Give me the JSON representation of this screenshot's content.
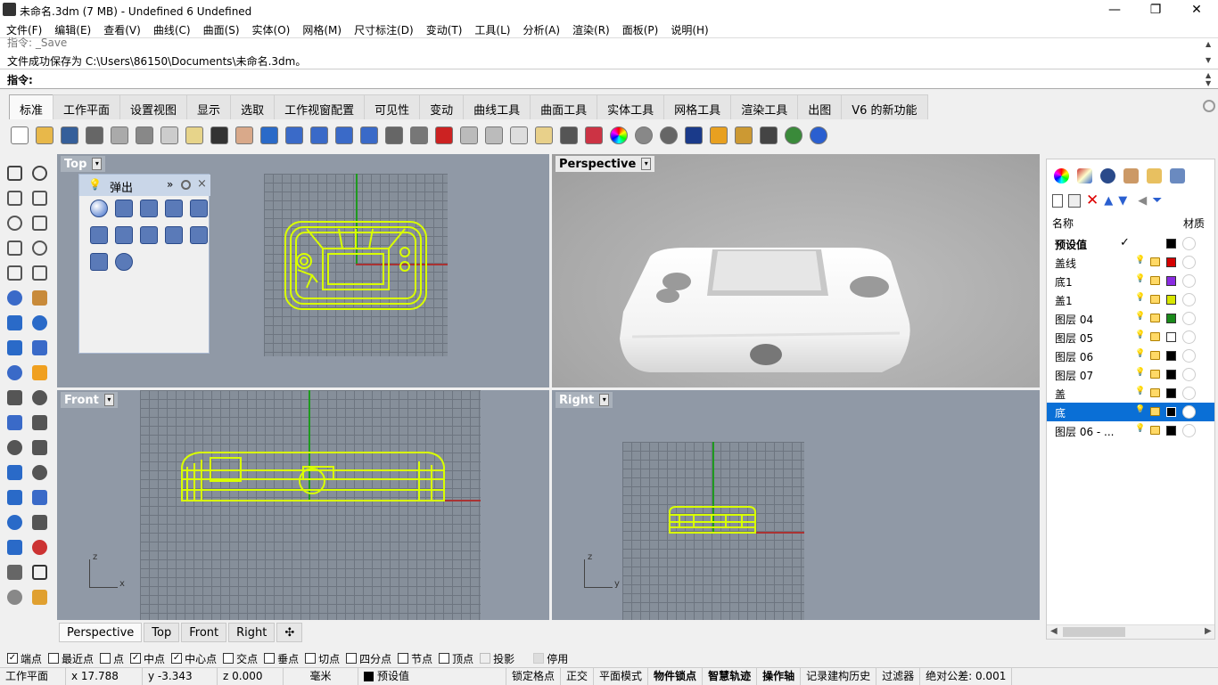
{
  "window": {
    "title": "未命名.3dm (7 MB) - Undefined 6 Undefined",
    "minimize": "—",
    "restore": "❐",
    "close": "✕"
  },
  "menu": [
    "文件(F)",
    "编辑(E)",
    "查看(V)",
    "曲线(C)",
    "曲面(S)",
    "实体(O)",
    "网格(M)",
    "尺寸标注(D)",
    "变动(T)",
    "工具(L)",
    "分析(A)",
    "渲染(R)",
    "面板(P)",
    "说明(H)"
  ],
  "command": {
    "history_line1": "指令: _Save",
    "history_line2": "文件成功保存为 C:\\Users\\86150\\Documents\\未命名.3dm。",
    "prompt_label": "指令:",
    "input_value": ""
  },
  "tabs": [
    "标准",
    "工作平面",
    "设置视图",
    "显示",
    "选取",
    "工作视窗配置",
    "可见性",
    "变动",
    "曲线工具",
    "曲面工具",
    "实体工具",
    "网格工具",
    "渲染工具",
    "出图",
    "V6 的新功能"
  ],
  "toolbar_icons": [
    "new-file-icon",
    "open-folder-icon",
    "save-icon",
    "print-icon",
    "import-icon",
    "cut-icon",
    "copy-icon",
    "paste-icon",
    "undo-icon",
    "pan-hand-icon",
    "move-view-icon",
    "zoom-icon",
    "zoom-window-icon",
    "zoom-extents-icon",
    "zoom-selected-icon",
    "rotate-view-icon",
    "four-viewports-icon",
    "car-icon",
    "hide-icon",
    "show-icon",
    "select-icon",
    "light-icon",
    "lock-icon",
    "layer-icon",
    "color-wheel-icon",
    "shaded-sphere-icon",
    "rendered-sphere-icon",
    "render-icon",
    "flag-icon",
    "gear-options-icon",
    "snap-icon",
    "globe-icon",
    "help-icon"
  ],
  "viewports": {
    "top": {
      "label": "Top",
      "dd": "▾"
    },
    "perspective": {
      "label": "Perspective",
      "dd": "▾"
    },
    "front": {
      "label": "Front",
      "dd": "▾",
      "axis_v": "z",
      "axis_h": "x"
    },
    "right": {
      "label": "Right",
      "dd": "▾",
      "axis_v": "z",
      "axis_h": "y"
    }
  },
  "viewport_tabs": [
    "Perspective",
    "Top",
    "Front",
    "Right",
    "✣"
  ],
  "popup": {
    "title": "弹出",
    "more": "»",
    "close": "×"
  },
  "layer_panel": {
    "col_name": "名称",
    "col_material": "材质",
    "layers": [
      {
        "name": "预设值",
        "color": "#000000",
        "current": true,
        "check": "✓"
      },
      {
        "name": "盖线",
        "color": "#d40000"
      },
      {
        "name": "底1",
        "color": "#8a2be2"
      },
      {
        "name": "盖1",
        "color": "#d7e600"
      },
      {
        "name": "图层 04",
        "color": "#1a8a1a"
      },
      {
        "name": "图层 05",
        "color": "#ffffff"
      },
      {
        "name": "图层 06",
        "color": "#000000"
      },
      {
        "name": "图层 07",
        "color": "#000000"
      },
      {
        "name": "盖",
        "color": "#000000"
      },
      {
        "name": "底",
        "color": "#000000",
        "selected": true
      },
      {
        "name": "图层 06 - ...",
        "color": "#000000"
      }
    ]
  },
  "osnap": [
    {
      "label": "端点",
      "checked": true
    },
    {
      "label": "最近点",
      "checked": false
    },
    {
      "label": "点",
      "checked": false
    },
    {
      "label": "中点",
      "checked": true
    },
    {
      "label": "中心点",
      "checked": true
    },
    {
      "label": "交点",
      "checked": false
    },
    {
      "label": "垂点",
      "checked": false
    },
    {
      "label": "切点",
      "checked": false
    },
    {
      "label": "四分点",
      "checked": false
    },
    {
      "label": "节点",
      "checked": false
    },
    {
      "label": "顶点",
      "checked": false
    },
    {
      "label": "投影",
      "checked": false
    },
    {
      "label": "停用",
      "checked": false
    }
  ],
  "status": {
    "cplane": "工作平面",
    "x": "x 17.788",
    "y": "y -3.343",
    "z": "z 0.000",
    "units": "毫米",
    "layer": "预设值",
    "items": [
      "锁定格点",
      "正交",
      "平面模式",
      "物件锁点",
      "智慧轨迹",
      "操作轴",
      "记录建构历史",
      "过滤器",
      "绝对公差: 0.001"
    ]
  },
  "colors": {
    "wire": "#d9ff00",
    "accent_selected": "#0a6fd6"
  }
}
